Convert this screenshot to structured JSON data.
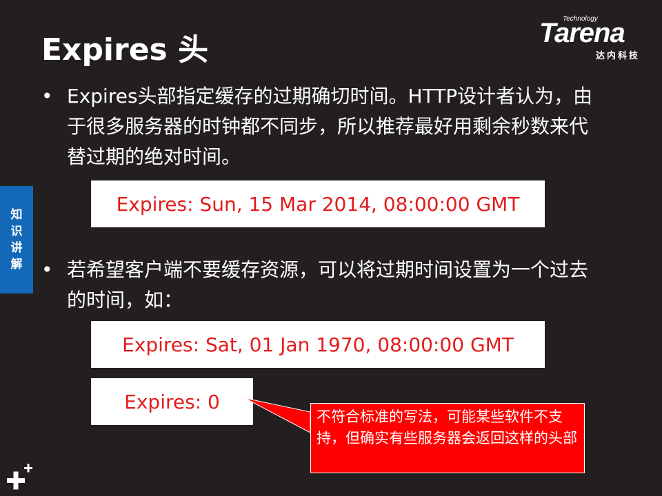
{
  "slide": {
    "title": "Expires 头",
    "logo": {
      "tagline": "Technology",
      "brand": "Tarena",
      "chinese": "达内科技"
    },
    "side_tab": [
      "知",
      "识",
      "讲",
      "解"
    ],
    "bullets": [
      {
        "marker": "•",
        "text": "Expires头部指定缓存的过期确切时间。HTTP设计者认为，由于很多服务器的时钟都不同步，所以推荐最好用剩余秒数来代替过期的绝对时间。"
      },
      {
        "marker": "•",
        "text": "若希望客户端不要缓存资源，可以将过期时间设置为一个过去的时间，如："
      }
    ],
    "code_examples": [
      "Expires: Sun, 15 Mar 2014, 08:00:00 GMT",
      "Expires: Sat, 01 Jan 1970, 08:00:00 GMT",
      "Expires: 0"
    ],
    "callout": "不符合标准的写法，可能某些软件不支持，但确实有些服务器会返回这样的头部"
  },
  "colors": {
    "background": "#231f20",
    "side_tab": "#1468b8",
    "code_text": "#e31c1c",
    "callout_bg": "#ff0000"
  }
}
